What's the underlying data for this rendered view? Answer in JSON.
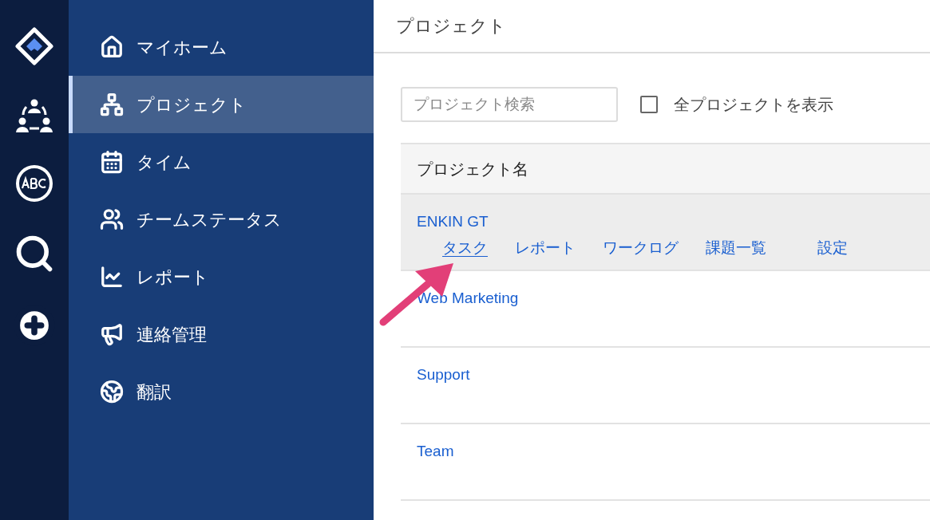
{
  "sidebar": {
    "items": [
      {
        "label": "マイホーム",
        "selected": false
      },
      {
        "label": "プロジェクト",
        "selected": true
      },
      {
        "label": "タイム",
        "selected": false
      },
      {
        "label": "チームステータス",
        "selected": false
      },
      {
        "label": "レポート",
        "selected": false
      },
      {
        "label": "連絡管理",
        "selected": false
      },
      {
        "label": "翻訳",
        "selected": false
      }
    ]
  },
  "header": {
    "title": "プロジェクト"
  },
  "search": {
    "placeholder": "プロジェクト検索"
  },
  "show_all": {
    "label": "全プロジェクトを表示",
    "checked": false
  },
  "table": {
    "columns": [
      "プロジェクト名"
    ],
    "rows": [
      {
        "name": "ENKIN GT",
        "selected": true,
        "actions": [
          {
            "label": "タスク",
            "hovered": true
          },
          {
            "label": "レポート",
            "hovered": false
          },
          {
            "label": "ワークログ",
            "hovered": false
          },
          {
            "label": "課題一覧",
            "hovered": false
          },
          {
            "label": "設定",
            "hovered": false
          }
        ]
      },
      {
        "name": "Web Marketing",
        "selected": false
      },
      {
        "name": "Support",
        "selected": false
      },
      {
        "name": "Team",
        "selected": false
      }
    ]
  }
}
